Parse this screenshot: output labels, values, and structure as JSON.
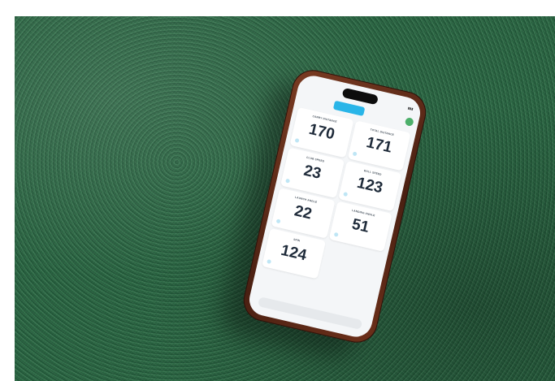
{
  "phone": {
    "app": {
      "header_button": "",
      "metrics": [
        {
          "label": "CARRY DISTANCE",
          "value": "170",
          "unit": ""
        },
        {
          "label": "TOTAL DISTANCE",
          "value": "171",
          "unit": ""
        },
        {
          "label": "CLUB SPEED",
          "value": "23",
          "unit": ""
        },
        {
          "label": "BALL SPEED",
          "value": "123",
          "unit": ""
        },
        {
          "label": "LAUNCH ANGLE",
          "value": "22",
          "unit": ""
        },
        {
          "label": "LANDING ANGLE",
          "value": "51",
          "unit": ""
        },
        {
          "label": "SPIN",
          "value": "124",
          "unit": ""
        }
      ]
    }
  },
  "colors": {
    "grass": "#2a6040",
    "phone_case": "#6d301a",
    "accent_button": "#29b5e8",
    "status_dot": "#4caf6a"
  }
}
